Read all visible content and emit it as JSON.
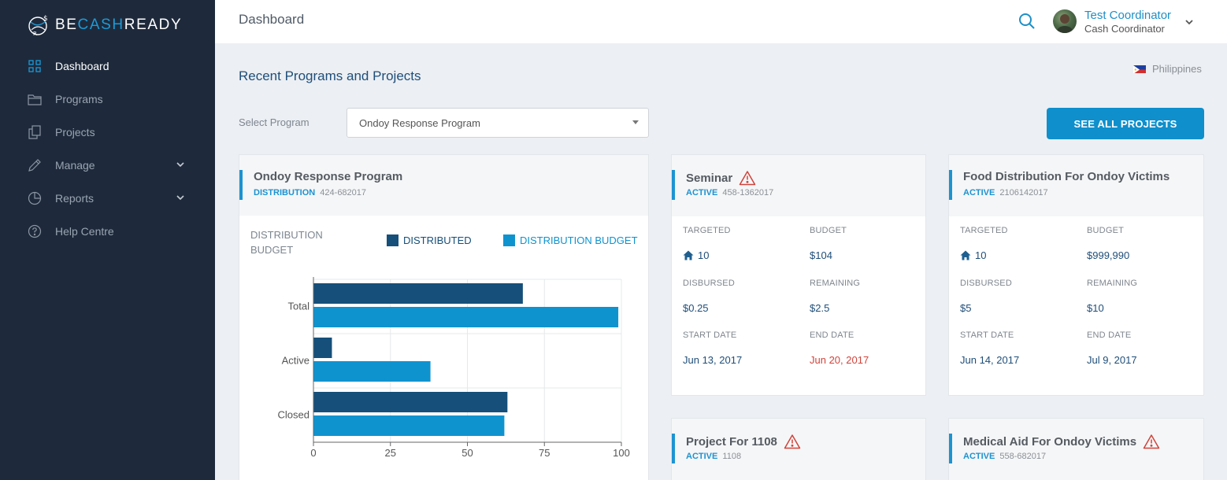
{
  "brand": {
    "prefix": "BE",
    "highlight": "CASH",
    "suffix": "READY",
    "accent": "#1d9ad6"
  },
  "sidebar": {
    "items": [
      {
        "label": "Dashboard",
        "icon": "grid-icon",
        "active": true
      },
      {
        "label": "Programs",
        "icon": "folder-icon"
      },
      {
        "label": "Projects",
        "icon": "copy-icon"
      },
      {
        "label": "Manage",
        "icon": "pencil-icon",
        "expandable": true
      },
      {
        "label": "Reports",
        "icon": "pie-chart-icon",
        "expandable": true
      },
      {
        "label": "Help Centre",
        "icon": "help-circle-icon"
      }
    ]
  },
  "header": {
    "title": "Dashboard",
    "user": {
      "name": "Test Coordinator",
      "role": "Cash Coordinator"
    }
  },
  "main": {
    "section_title": "Recent Programs and Projects",
    "country": "Philippines",
    "select_label": "Select Program",
    "selected_program": "Ondoy Response Program",
    "see_all_label": "SEE ALL PROJECTS"
  },
  "program_card": {
    "title": "Ondoy Response Program",
    "status": "DISTRIBUTION",
    "code": "424-682017",
    "metric_label": "DISTRIBUTION BUDGET",
    "legend": [
      {
        "label": "DISTRIBUTED",
        "color": "#154f7a"
      },
      {
        "label": "DISTRIBUTION BUDGET",
        "color": "#0f93cf"
      }
    ]
  },
  "chart_data": {
    "type": "bar",
    "orientation": "horizontal",
    "categories": [
      "Total",
      "Active",
      "Closed"
    ],
    "series": [
      {
        "name": "DISTRIBUTED",
        "values": [
          68,
          6,
          63
        ]
      },
      {
        "name": "DISTRIBUTION BUDGET",
        "values": [
          99,
          38,
          62
        ]
      }
    ],
    "xlim": [
      0,
      100
    ],
    "xticks": [
      0,
      25,
      50,
      75,
      100
    ],
    "grid": true,
    "legend_position": "top-right"
  },
  "project_labels": {
    "targeted": "TARGETED",
    "budget": "BUDGET",
    "disbursed": "DISBURSED",
    "remaining": "REMAINING",
    "start_date": "START DATE",
    "end_date": "END DATE"
  },
  "projects": [
    {
      "title": "Seminar",
      "warning": true,
      "status": "ACTIVE",
      "code": "458-1362017",
      "targeted": "10",
      "budget": "$104",
      "disbursed": "$0.25",
      "remaining": "$2.5",
      "start_date": "Jun 13, 2017",
      "end_date": "Jun 20, 2017",
      "end_overdue": true
    },
    {
      "title": "Food Distribution For Ondoy Victims",
      "warning": false,
      "status": "ACTIVE",
      "code": "2106142017",
      "targeted": "10",
      "budget": "$999,990",
      "disbursed": "$5",
      "remaining": "$10",
      "start_date": "Jun 14, 2017",
      "end_date": "Jul 9, 2017",
      "end_overdue": false
    },
    {
      "title": "Project For 1108",
      "warning": true,
      "status": "ACTIVE",
      "code": "1108"
    },
    {
      "title": "Medical Aid For Ondoy Victims",
      "warning": true,
      "status": "ACTIVE",
      "code": "558-682017"
    }
  ],
  "colors": {
    "sidebar_bg": "#1e2a3b",
    "primary": "#0f8fcc",
    "overdue": "#d0433b",
    "warning": "#d0433b"
  }
}
